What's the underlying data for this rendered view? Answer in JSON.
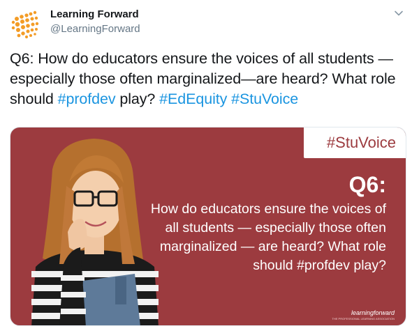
{
  "account": {
    "name": "Learning Forward",
    "handle": "@LearningForward",
    "avatar_icon": "orange-dot-burst-logo"
  },
  "tweet": {
    "text_parts": [
      {
        "text": "Q6: How do educators ensure the voices of all students —especially those often marginalized—are heard? What role should ",
        "type": "text"
      },
      {
        "text": "#profdev",
        "type": "hashtag"
      },
      {
        "text": " play? ",
        "type": "text"
      },
      {
        "text": "#EdEquity",
        "type": "hashtag"
      },
      {
        "text": " ",
        "type": "text"
      },
      {
        "text": "#StuVoice",
        "type": "hashtag"
      }
    ]
  },
  "card": {
    "hashtag": "#StuVoice",
    "question_label": "Q6:",
    "body": "How do educators ensure the voices of all students — especially those often marginalized — are heard? What role should #profdev play?",
    "logo_text": "learningforward",
    "logo_subtext": "THE PROFESSIONAL LEARNING ASSOCIATION",
    "background_color": "#9c3b3f"
  },
  "colors": {
    "hashtag": "#1b95e0",
    "brand_orange": "#f39c26"
  },
  "icons": {
    "more_menu": "chevron-down-icon"
  }
}
